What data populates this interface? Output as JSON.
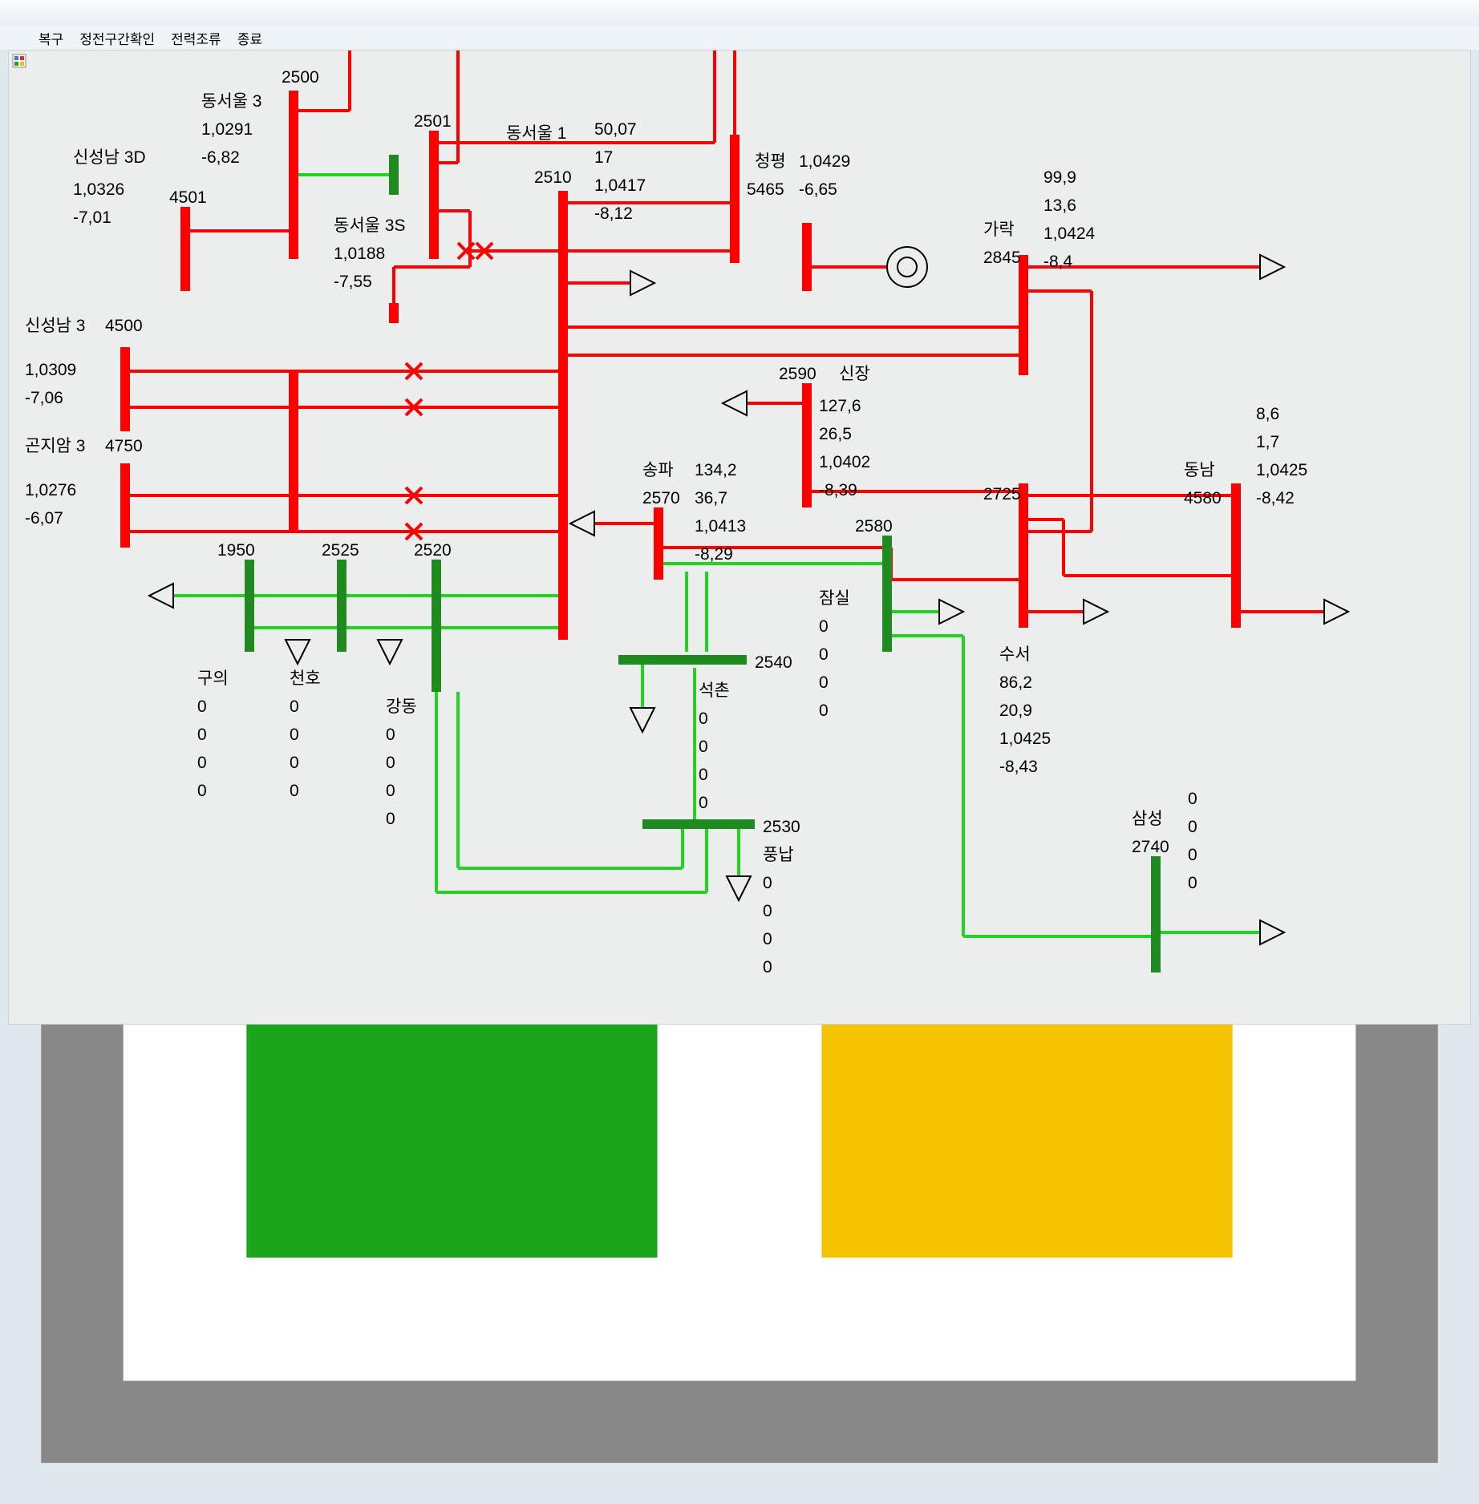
{
  "menu": {
    "recover": "복구",
    "outage": "정전구간확인",
    "powerflow": "전력조류",
    "exit": "종료"
  },
  "buses": {
    "b2500": {
      "name": "동서울 3",
      "id": "2500",
      "v": "1,0291",
      "a": "-6,82"
    },
    "b2501": {
      "id": "2501"
    },
    "b2510": {
      "name": "동서울 1",
      "id": "2510",
      "p": "50,07",
      "q": "17",
      "v": "1,0417",
      "a": "-8,12"
    },
    "b2501s": {
      "name": "동서울 3S",
      "v": "1,0188",
      "a": "-7,55"
    },
    "b5465": {
      "name": "청평",
      "id": "5465",
      "v": "1,0429",
      "a": "-6,65"
    },
    "b2845": {
      "name": "가락",
      "id": "2845",
      "p": "99,9",
      "q": "13,6",
      "v": "1,0424",
      "a": "-8,4"
    },
    "b4501": {
      "name": "신성남 3D",
      "id": "4501",
      "v": "1,0326",
      "a": "-7,01"
    },
    "b4500": {
      "name": "신성남 3",
      "id": "4500",
      "v": "1,0309",
      "a": "-7,06"
    },
    "b4750": {
      "name": "곤지암 3",
      "id": "4750",
      "v": "1,0276",
      "a": "-6,07"
    },
    "b2590": {
      "name": "신장",
      "id": "2590",
      "p": "127,6",
      "q": "26,5",
      "v": "1,0402",
      "a": "-8,39"
    },
    "b2570": {
      "name": "송파",
      "id": "2570",
      "p": "134,2",
      "q": "36,7",
      "v": "1,0413",
      "a": "-8,29"
    },
    "b2580": {
      "name": "잠실",
      "id": "2580",
      "p": "0",
      "q": "0",
      "v": "0",
      "a": "0"
    },
    "b2725": {
      "id": "2725",
      "name": "수서",
      "p": "86,2",
      "q": "20,9",
      "v": "1,0425",
      "a": "-8,43"
    },
    "b4580": {
      "name": "동남",
      "id": "4580",
      "p": "8,6",
      "q": "1,7",
      "v": "1,0425",
      "a": "-8,42"
    },
    "b1950": {
      "name": "구의",
      "id": "1950",
      "p": "0",
      "q": "0",
      "v": "0",
      "a": "0"
    },
    "b2525": {
      "name": "천호",
      "id": "2525",
      "p": "0",
      "q": "0",
      "v": "0",
      "a": "0"
    },
    "b2520": {
      "name": "강동",
      "id": "2520",
      "p": "0",
      "q": "0",
      "v": "0",
      "a": "0"
    },
    "b2540": {
      "name": "석촌",
      "id": "2540",
      "p": "0",
      "q": "0",
      "v": "0",
      "a": "0"
    },
    "b2530": {
      "name": "풍납",
      "id": "2530",
      "p": "0",
      "q": "0",
      "v": "0",
      "a": "0"
    },
    "b2740": {
      "name": "삼성",
      "id": "2740",
      "p": "0",
      "q": "0",
      "v": "0",
      "a": "0"
    }
  }
}
